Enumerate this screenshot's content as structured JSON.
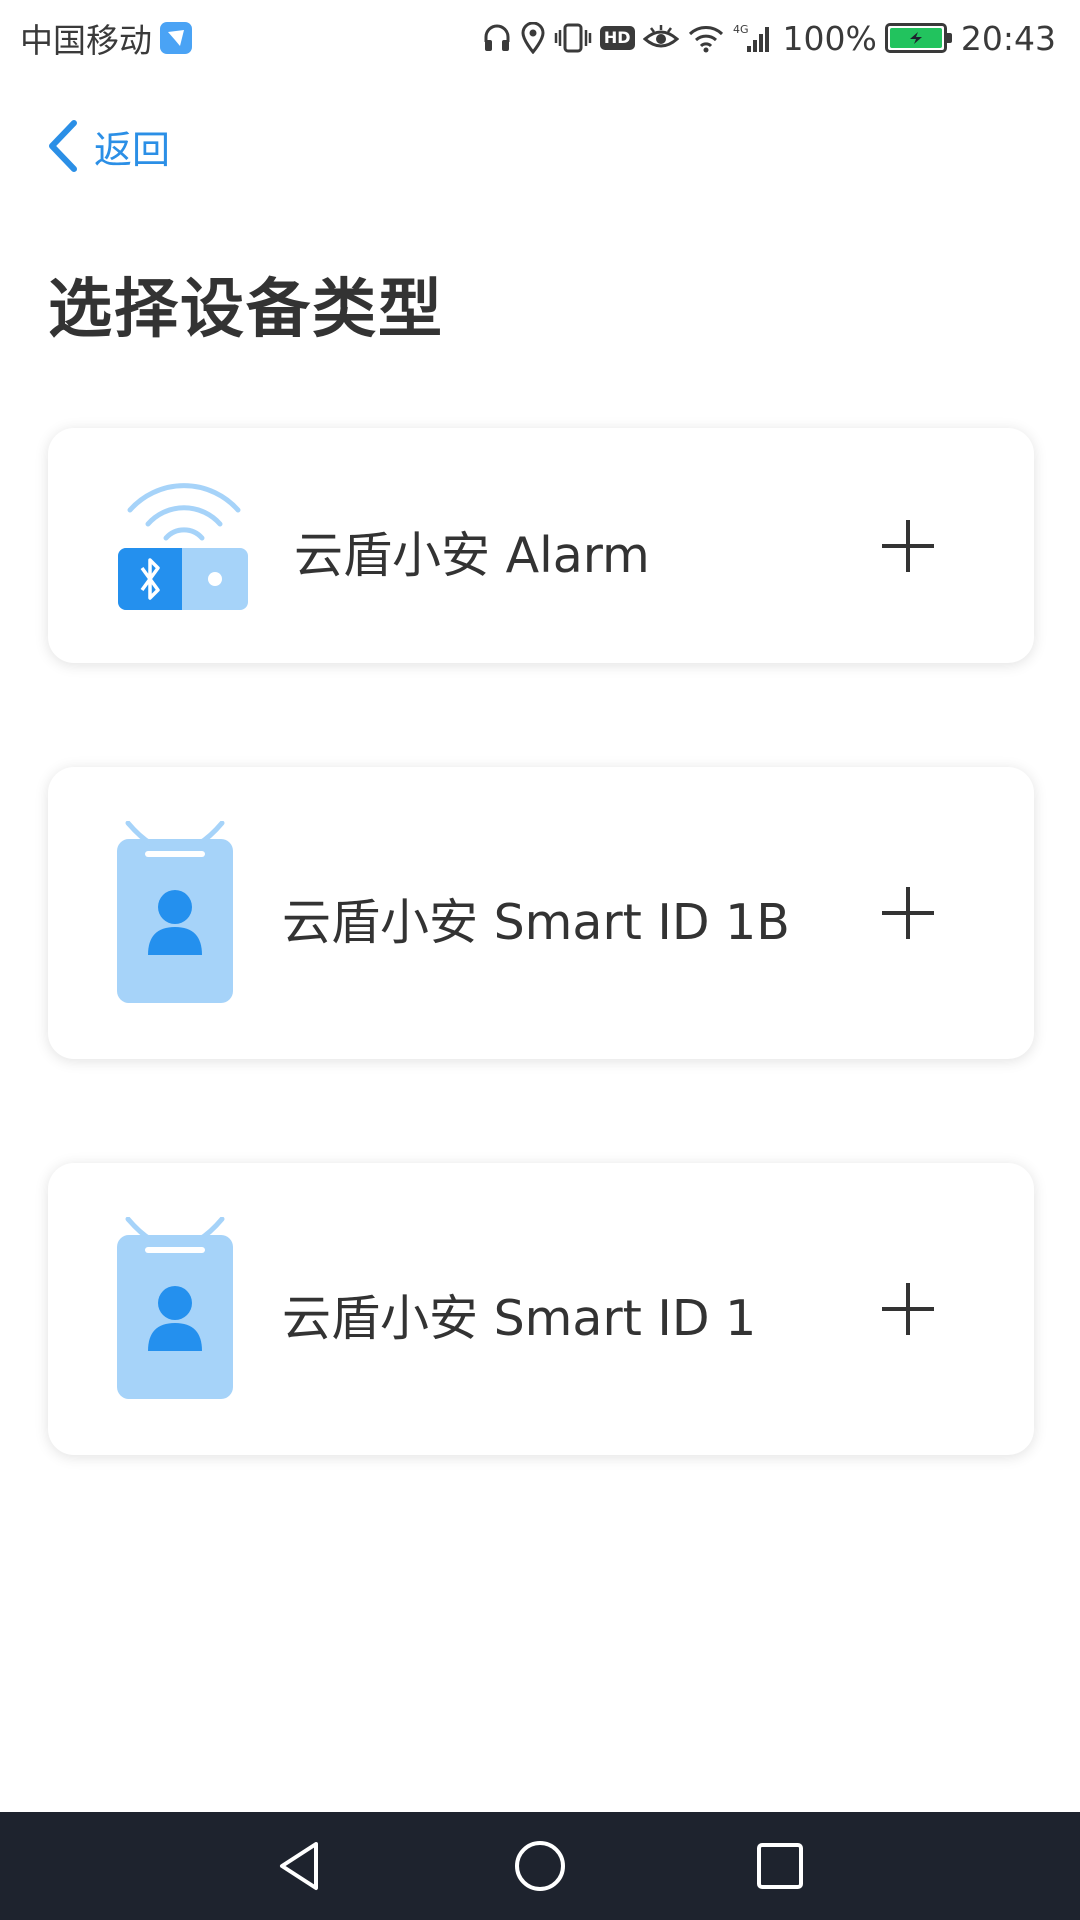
{
  "status_bar": {
    "carrier": "中国移动",
    "network": "4G",
    "battery": "100%",
    "time": "20:43",
    "hd_label": "HD"
  },
  "nav": {
    "back_label": "返回"
  },
  "page": {
    "title": "选择设备类型"
  },
  "devices": [
    {
      "label": "云盾小安 Alarm",
      "icon": "alarm-device-icon",
      "action_icon": "plus-icon"
    },
    {
      "label": "云盾小安 Smart ID 1B",
      "icon": "id-badge-icon",
      "action_icon": "plus-icon"
    },
    {
      "label": "云盾小安 Smart ID 1",
      "icon": "id-badge-icon",
      "action_icon": "plus-icon"
    }
  ],
  "colors": {
    "accent": "#2b8fe6",
    "icon_light": "#a6d3f9",
    "icon_dark": "#2490ee",
    "nav_bg": "#1e232e",
    "battery": "#22c35e"
  }
}
